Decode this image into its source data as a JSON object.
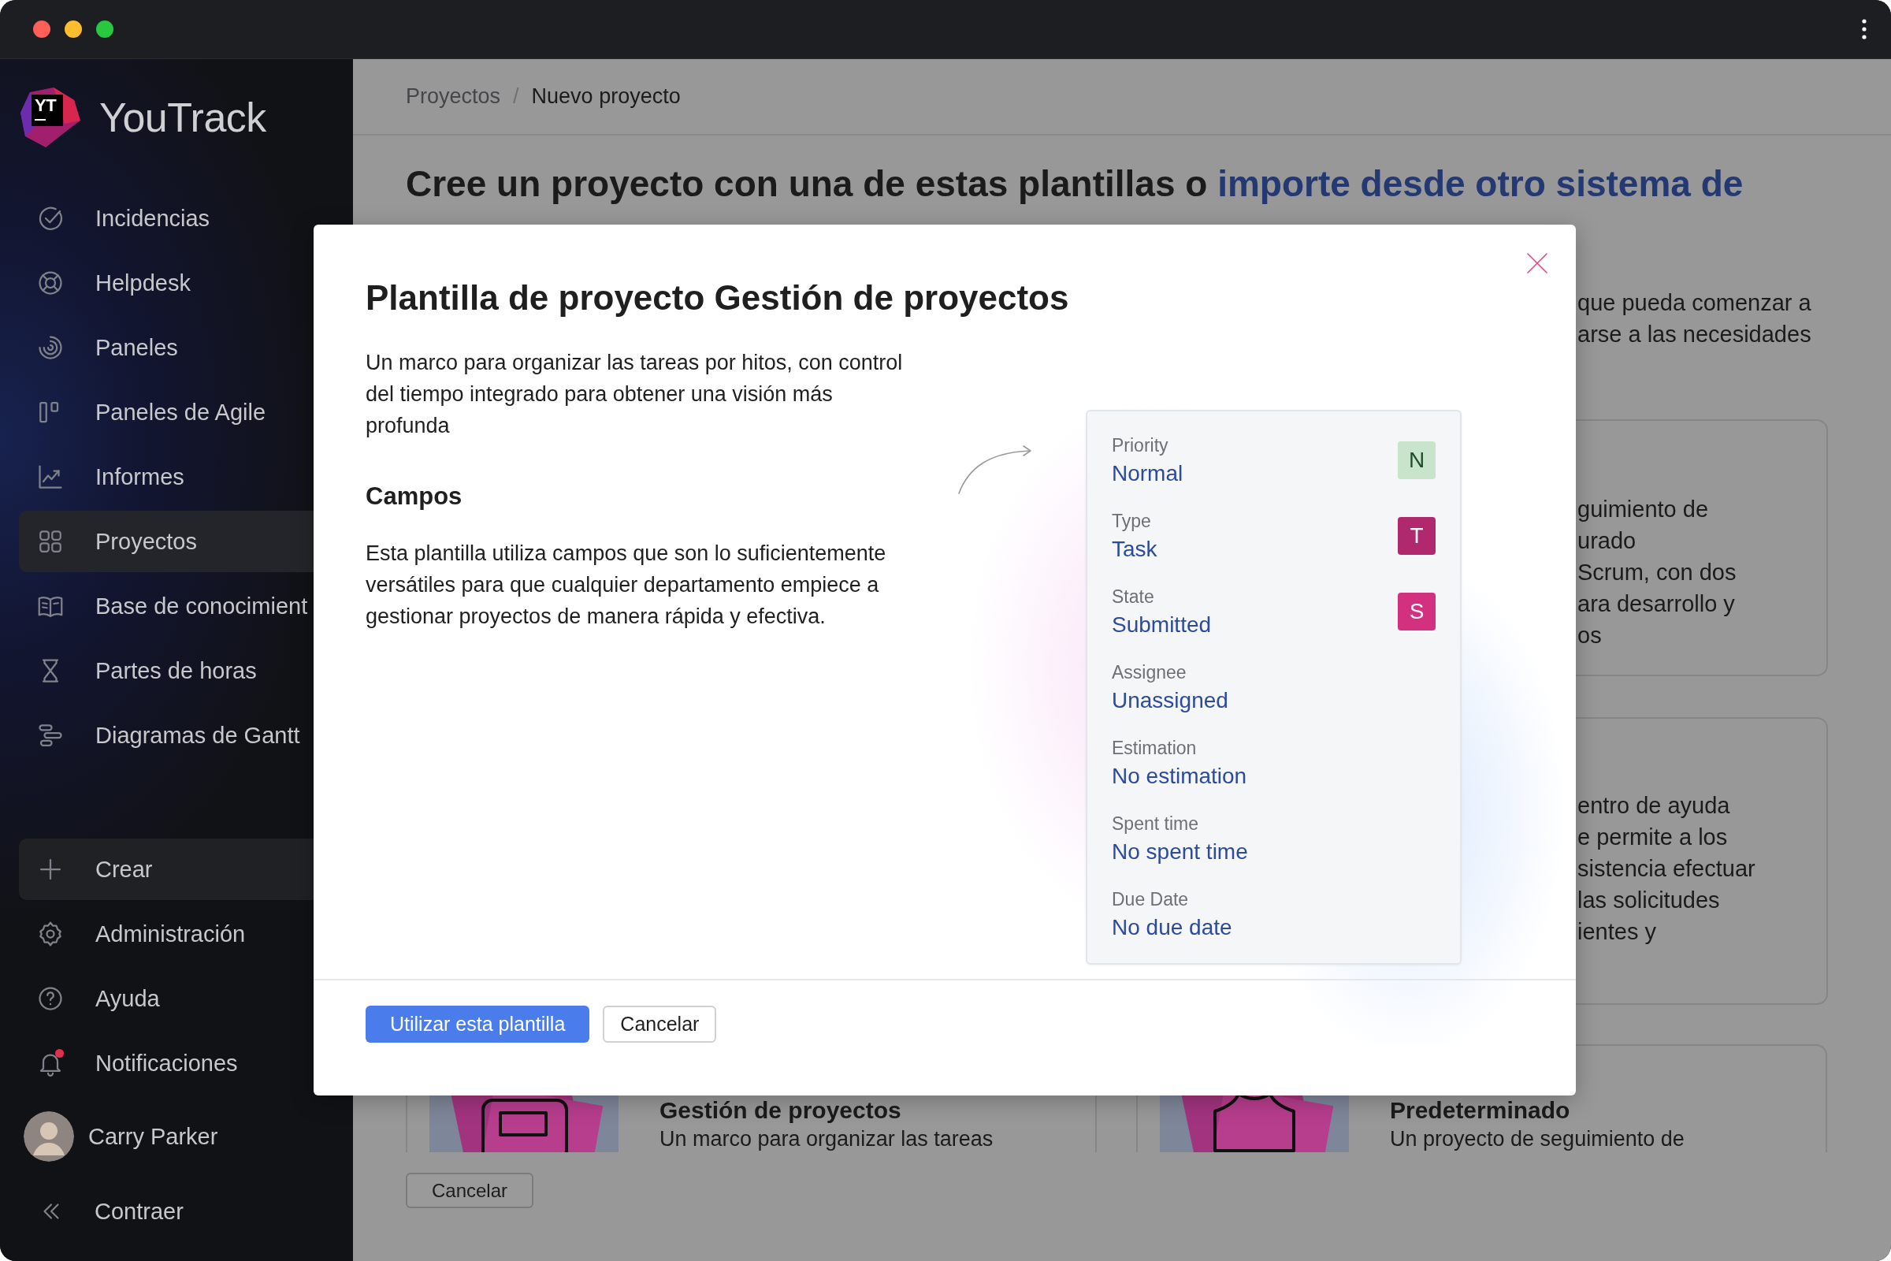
{
  "sidebar": {
    "logo": {
      "mark": "YT",
      "name": "YouTrack"
    },
    "nav": [
      {
        "label": "Incidencias",
        "selected": false
      },
      {
        "label": "Helpdesk",
        "selected": false
      },
      {
        "label": "Paneles",
        "selected": false
      },
      {
        "label": "Paneles de Agile",
        "selected": false
      },
      {
        "label": "Informes",
        "selected": false
      },
      {
        "label": "Proyectos",
        "selected": true
      },
      {
        "label": "Base de conocimient",
        "selected": false
      },
      {
        "label": "Partes de horas",
        "selected": false
      },
      {
        "label": "Diagramas de Gantt",
        "selected": false
      }
    ],
    "actions": [
      {
        "label": "Crear",
        "kind": "button",
        "unread": false
      },
      {
        "label": "Administración",
        "kind": "link",
        "unread": false
      },
      {
        "label": "Ayuda",
        "kind": "link",
        "unread": false
      },
      {
        "label": "Notificaciones",
        "kind": "link",
        "unread": true
      }
    ],
    "user": {
      "name": "Carry Parker"
    },
    "collapse": {
      "label": "Contraer"
    }
  },
  "page": {
    "breadcrumbs": [
      {
        "label": "Proyectos",
        "current": false
      },
      {
        "label": "Nuevo proyecto",
        "current": true
      }
    ],
    "breadcrumb_separator": "/",
    "heading": {
      "text": "Cree un proyecto con una de estas plantillas o",
      "link": "importe desde otro sistema de"
    },
    "intro_fragment": [
      "que pueda comenzar a",
      "arse a las necesidades"
    ],
    "side_cards": [
      {
        "lines": [
          "guimiento de",
          "urado",
          "Scrum, con dos",
          "ara desarrollo y",
          "os"
        ]
      },
      {
        "lines": [
          "entro de ayuda",
          "e permite a los",
          "sistencia efectuar",
          "las solicitudes",
          "ientes y"
        ]
      }
    ],
    "template_cards": [
      {
        "title": "Gestión de proyectos",
        "description": "Un marco para organizar las tareas"
      },
      {
        "title": "Predeterminado",
        "description": "Un proyecto de seguimiento de"
      }
    ],
    "cancel_button": "Cancelar"
  },
  "modal": {
    "title": "Plantilla de proyecto Gestión de proyectos",
    "description": "Un marco para organizar las tareas por hitos, con control del tiempo integrado para obtener una visión más profunda",
    "section_title": "Campos",
    "section_text": "Esta plantilla utiliza campos que son lo suficientemente versátiles para que cualquier departamento empiece a gestionar proyectos de manera rápida y efectiva.",
    "fields": [
      {
        "label": "Priority",
        "value": "Normal",
        "badge": "N",
        "color": "#c8e5cc"
      },
      {
        "label": "Type",
        "value": "Task",
        "badge": "T",
        "color": "#b0286e"
      },
      {
        "label": "State",
        "value": "Submitted",
        "badge": "S",
        "color": "#d33180"
      },
      {
        "label": "Assignee",
        "value": "Unassigned"
      },
      {
        "label": "Estimation",
        "value": "No estimation"
      },
      {
        "label": "Spent time",
        "value": "No spent time"
      },
      {
        "label": "Due Date",
        "value": "No due date"
      }
    ],
    "primary_button": "Utilizar esta plantilla",
    "secondary_button": "Cancelar"
  }
}
